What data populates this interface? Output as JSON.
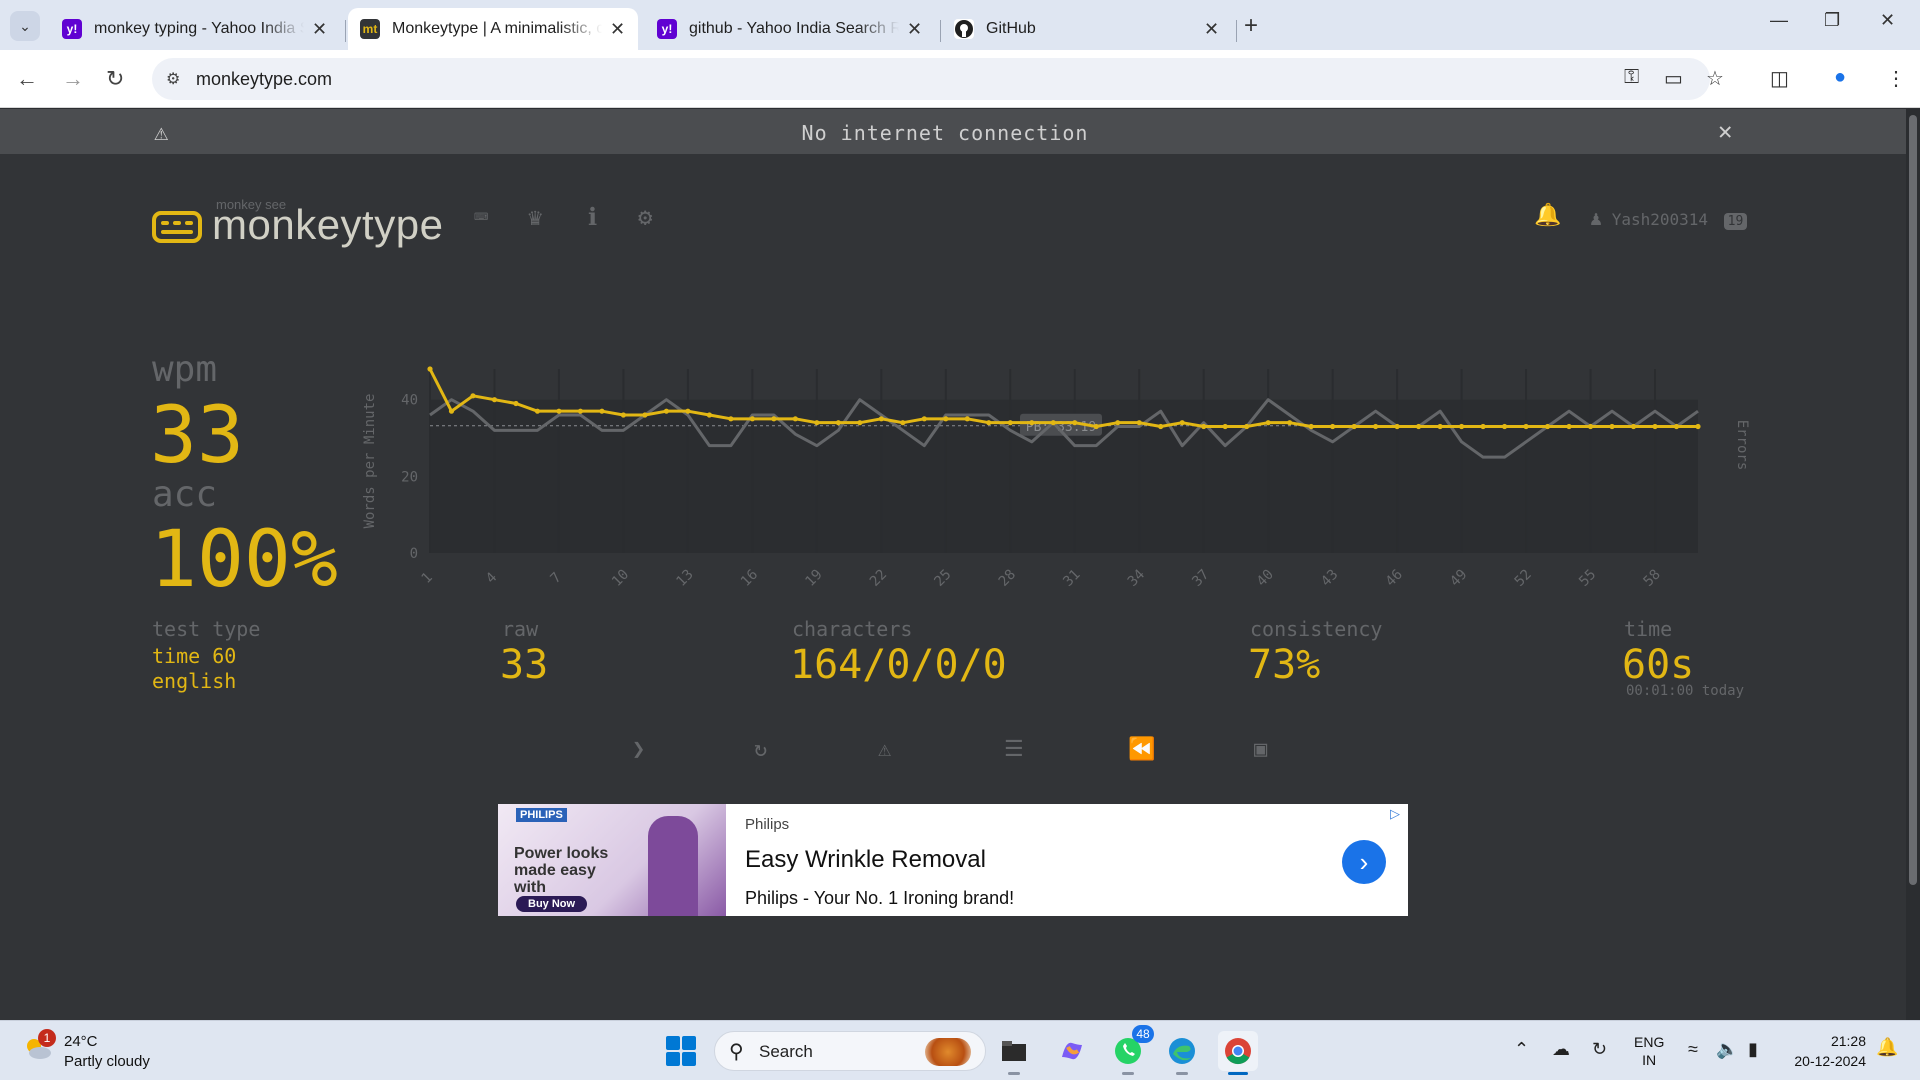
{
  "browser": {
    "tabs": [
      {
        "title": "monkey typing - Yahoo India Se",
        "icon": "yahoo-icon",
        "active": false
      },
      {
        "title": "Monkeytype | A minimalistic, cu",
        "icon": "monkeytype-icon",
        "active": true
      },
      {
        "title": "github - Yahoo India Search Res",
        "icon": "yahoo-icon",
        "active": false
      },
      {
        "title": "GitHub",
        "icon": "github-icon",
        "active": false
      }
    ],
    "url": "monkeytype.com"
  },
  "banner": {
    "message": "No internet connection"
  },
  "header": {
    "logo_sub": "monkey see",
    "logo_name": "monkeytype",
    "username": "Yash200314",
    "level": "19"
  },
  "result": {
    "wpm_label": "wpm",
    "wpm": "33",
    "acc_label": "acc",
    "acc": "100%",
    "test_type_label": "test type",
    "test_type_line1": "time 60",
    "test_type_line2": "english",
    "raw_label": "raw",
    "raw": "33",
    "characters_label": "characters",
    "characters": "164/0/0/0",
    "consistency_label": "consistency",
    "consistency": "73%",
    "time_label": "time",
    "time": "60s",
    "time_note": "00:01:00 today"
  },
  "chart_data": {
    "type": "line",
    "ylabel": "Words per Minute",
    "y2label": "Errors",
    "ylim": [
      0,
      40
    ],
    "yticks": [
      0,
      20,
      40
    ],
    "x": [
      1,
      2,
      3,
      4,
      5,
      6,
      7,
      8,
      9,
      10,
      11,
      12,
      13,
      14,
      15,
      16,
      17,
      18,
      19,
      20,
      21,
      22,
      23,
      24,
      25,
      26,
      27,
      28,
      29,
      30,
      31,
      32,
      33,
      34,
      35,
      36,
      37,
      38,
      39,
      40,
      41,
      42,
      43,
      44,
      45,
      46,
      47,
      48,
      49,
      50,
      51,
      52,
      53,
      54,
      55,
      56,
      57,
      58,
      59,
      60
    ],
    "xticks": [
      1,
      4,
      7,
      10,
      13,
      16,
      19,
      22,
      25,
      28,
      31,
      34,
      37,
      40,
      43,
      46,
      49,
      52,
      55,
      58
    ],
    "pb_label": "PB: 33.19",
    "pb_value": 33.19,
    "series": [
      {
        "name": "wpm",
        "color": "#e2b714",
        "values": [
          48,
          37,
          41,
          40,
          39,
          37,
          37,
          37,
          37,
          36,
          36,
          37,
          37,
          36,
          35,
          35,
          35,
          35,
          34,
          34,
          34,
          35,
          34,
          35,
          35,
          35,
          34,
          34,
          34,
          34,
          34,
          33,
          34,
          34,
          33,
          34,
          33,
          33,
          33,
          34,
          34,
          33,
          33,
          33,
          33,
          33,
          33,
          33,
          33,
          33,
          33,
          33,
          33,
          33,
          33,
          33,
          33,
          33,
          33,
          33
        ]
      },
      {
        "name": "raw",
        "color": "#646669",
        "values": [
          36,
          40,
          37,
          32,
          32,
          32,
          36,
          36,
          32,
          32,
          36,
          40,
          36,
          28,
          28,
          36,
          36,
          31,
          28,
          32,
          40,
          36,
          32,
          28,
          36,
          36,
          36,
          32,
          29,
          34,
          28,
          28,
          33,
          33,
          37,
          28,
          34,
          28,
          33,
          40,
          36,
          32,
          29,
          33,
          37,
          33,
          33,
          37,
          29,
          25,
          25,
          29,
          33,
          37,
          33,
          37,
          33,
          37,
          33,
          37
        ]
      }
    ]
  },
  "actions": [
    {
      "name": "next-test",
      "icon": "chevron-right-icon"
    },
    {
      "name": "restart-test",
      "icon": "refresh-icon"
    },
    {
      "name": "practice-words",
      "icon": "warning-icon"
    },
    {
      "name": "words-history",
      "icon": "align-left-icon"
    },
    {
      "name": "watch-replay",
      "icon": "rewind-icon"
    },
    {
      "name": "save-screenshot",
      "icon": "image-icon"
    }
  ],
  "ad": {
    "image_brand": "PHILIPS",
    "image_text": "Power looks made easy with",
    "image_cta": "Buy Now",
    "advertiser": "Philips",
    "headline": "Easy Wrinkle Removal",
    "description": "Philips - Your No. 1 Ironing brand!"
  },
  "taskbar": {
    "weather_badge": "1",
    "temperature": "24°C",
    "condition": "Partly cloudy",
    "search_label": "Search",
    "whatsapp_badge": "48",
    "lang_line1": "ENG",
    "lang_line2": "IN",
    "time": "21:28",
    "date": "20-12-2024"
  },
  "colors": {
    "accent": "#e2b714",
    "sub": "#646669",
    "bg": "#323437"
  }
}
